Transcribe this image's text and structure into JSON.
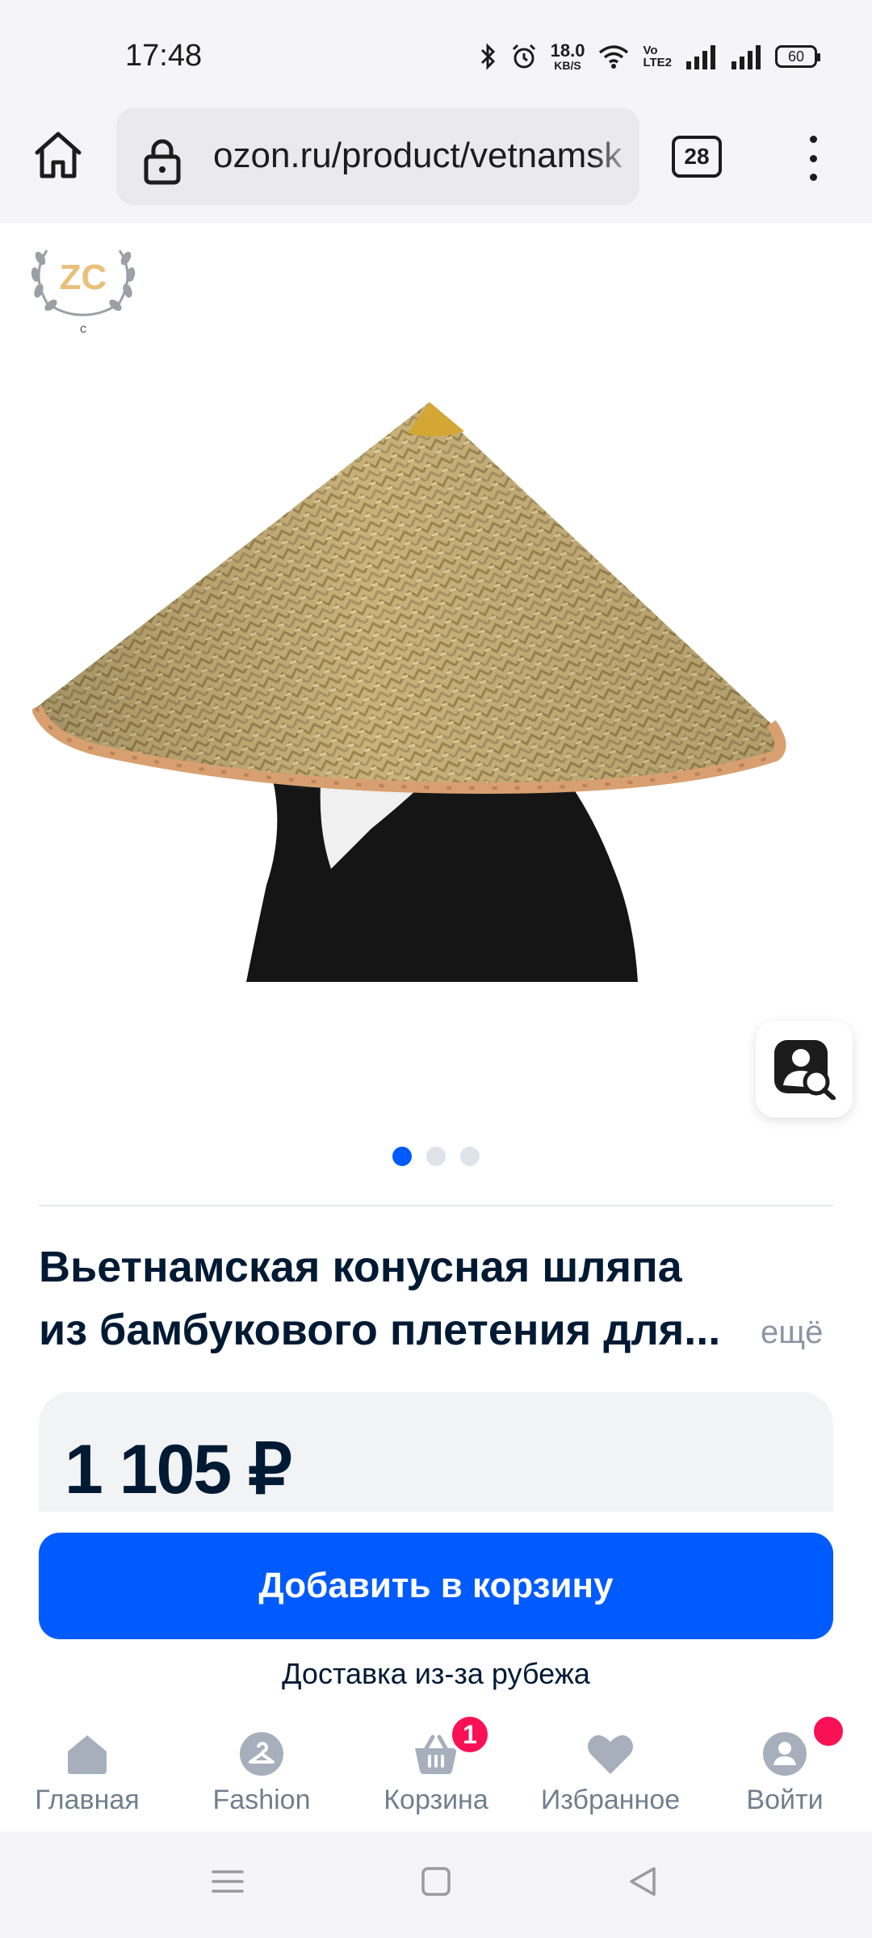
{
  "status_bar": {
    "time": "17:48",
    "net_speed_value": "18.0",
    "net_speed_unit": "KB/S",
    "volte": "Vo\nLTE2",
    "battery": "60"
  },
  "browser": {
    "url": "ozon.ru/product/vetnamsk",
    "tabs_count": "28"
  },
  "gallery": {
    "brand_logo_text": "ZC",
    "brand_logo_sub": "c",
    "pages": 3,
    "active_page": 1
  },
  "product": {
    "title": "Вьетнамская конусная шляпа из бамбукового плетения для...",
    "more_label": "ещё",
    "price": "1 105 ₽",
    "add_to_cart_label": "Добавить в корзину",
    "delivery_note": "Доставка из-за рубежа"
  },
  "bottom_nav": {
    "items": [
      {
        "label": "Главная",
        "icon": "home-icon"
      },
      {
        "label": "Fashion",
        "icon": "hanger-icon"
      },
      {
        "label": "Корзина",
        "icon": "basket-icon",
        "badge": "1"
      },
      {
        "label": "Избранное",
        "icon": "heart-icon"
      },
      {
        "label": "Войти",
        "icon": "profile-icon"
      }
    ]
  },
  "colors": {
    "accent": "#005bff",
    "badge": "#f91155",
    "text": "#001a34",
    "muted": "#707f8d"
  }
}
